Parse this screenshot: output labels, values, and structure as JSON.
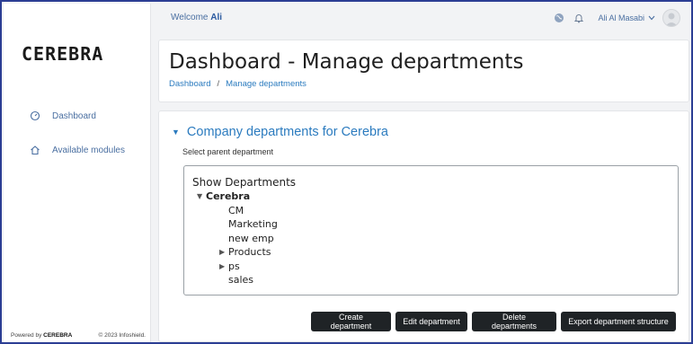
{
  "app": {
    "logo": "CEREBRA"
  },
  "sidebar": {
    "items": [
      {
        "label": "Dashboard",
        "icon": "gauge-icon"
      },
      {
        "label": "Available modules",
        "icon": "home-icon"
      }
    ],
    "footer": {
      "powered_prefix": "Powered by",
      "powered_brand": "CEREBRA",
      "copyright": "© 2023 Infoshield."
    }
  },
  "topbar": {
    "welcome_text": "Welcome",
    "welcome_user": "Ali",
    "user_name": "Ali Al Masabi"
  },
  "header": {
    "title": "Dashboard - Manage departments",
    "breadcrumb": [
      "Dashboard",
      "Manage departments"
    ]
  },
  "main": {
    "section_title": "Company departments for Cerebra",
    "select_label": "Select parent department",
    "tree": {
      "heading": "Show Departments",
      "root": "Cerebra",
      "children": [
        {
          "label": "CM",
          "expandable": false
        },
        {
          "label": "Marketing",
          "expandable": false
        },
        {
          "label": "new emp",
          "expandable": false
        },
        {
          "label": "Products",
          "expandable": true
        },
        {
          "label": "ps",
          "expandable": true
        },
        {
          "label": "sales",
          "expandable": false
        }
      ]
    },
    "buttons": {
      "create": "Create department",
      "edit": "Edit department",
      "delete": "Delete departments",
      "export": "Export department structure"
    }
  },
  "colors": {
    "frame_border": "#2c3e94",
    "link": "#2b7bbf",
    "button_bg": "#1f2326",
    "page_bg": "#f2f3f5"
  }
}
